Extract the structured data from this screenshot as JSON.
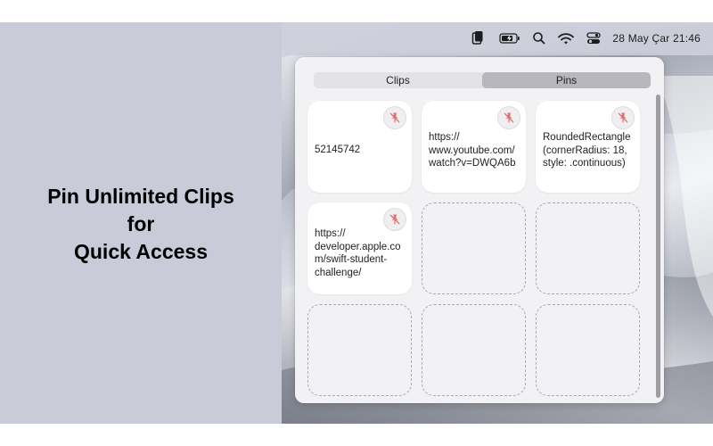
{
  "headline": {
    "line1": "Pin Unlimited Clips",
    "line2": "for",
    "line3": "Quick Access"
  },
  "menubar": {
    "icons": [
      "clipboard-app-icon",
      "battery-charging-icon",
      "search-icon",
      "wifi-icon",
      "control-center-icon"
    ],
    "clock": "28 May Çar  21:46"
  },
  "tabs": {
    "clips_label": "Clips",
    "pins_label": "Pins",
    "selected": "Pins"
  },
  "pins": [
    {
      "text": "52145742"
    },
    {
      "text": "https://\nwww.youtube.com/\nwatch?v=DWQA6b"
    },
    {
      "text": "RoundedRectangle\n(cornerRadius: 18,\nstyle: .continuous)"
    },
    {
      "text": "https://\ndeveloper.apple.co\nm/swift-student-\nchallenge/"
    }
  ],
  "colors": {
    "left_panel": "#c9cbd9",
    "popover": "#f2f2f4",
    "selected_tab": "#b7b7bd",
    "unpin_icon": "#e0726f"
  }
}
